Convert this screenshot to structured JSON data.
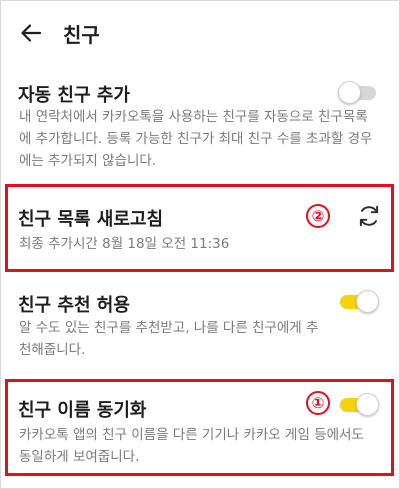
{
  "header": {
    "title": "친구",
    "back_icon": "arrow-left-icon"
  },
  "auto_add": {
    "title": "자동 친구 추가",
    "description": "내 연락처에서 카카오톡을 사용하는 친구를 자동으로 친구목록에 추가합니다. 등록 가능한 친구가 최대 친구 수를 초과할 경우에는 추가되지 않습니다.",
    "enabled": false
  },
  "refresh_list": {
    "title": "친구 목록 새로고침",
    "last_added": "최종 추가시간 8월 18일 오전 11:36",
    "icon": "refresh-icon",
    "marker": "②"
  },
  "recommend": {
    "title": "친구 추천 허용",
    "description": "알 수도 있는 친구를 추천받고, 나를 다른 친구에게 추천해줍니다.",
    "enabled": true
  },
  "name_sync": {
    "title": "친구 이름 동기화",
    "description": "카카오톡 앱의 친구 이름을 다른 기기나 카카오 게임 등에서도 동일하게 보여줍니다.",
    "enabled": true,
    "marker": "①"
  },
  "colors": {
    "toggle_on": "#f5d20b",
    "toggle_off": "#d6d6d6",
    "highlight": "#e0101e"
  }
}
